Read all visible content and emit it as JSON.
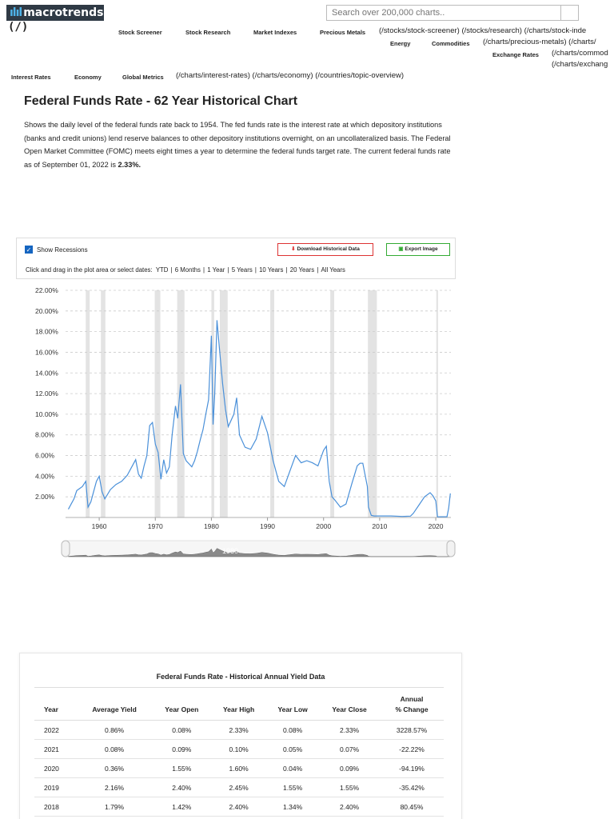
{
  "header": {
    "logo": "macrotrends",
    "logo_link": "(/)",
    "search_placeholder": "Search over 200,000 charts.."
  },
  "nav": {
    "stock_screener": "Stock Screener",
    "stock_research": "Stock Research",
    "market_indexes": "Market Indexes",
    "precious_metals": "Precious Metals",
    "energy": "Energy",
    "commodities": "Commodities",
    "exchange_rates": "Exchange Rates",
    "interest_rates": "Interest Rates",
    "economy": "Economy",
    "global_metrics": "Global Metrics",
    "links_1": "(/stocks/stock-screener) (/stocks/research) (/charts/stock-inde",
    "links_2": "(/charts/precious-metals) (/charts/",
    "links_3": "(/charts/commod",
    "links_4": "(/charts/exchang",
    "links_5": "(/charts/interest-rates) (/charts/economy) (/countries/topic-overview)"
  },
  "page": {
    "title": "Federal Funds Rate - 62 Year Historical Chart",
    "intro_main": "Shows the daily level of the federal funds rate back to 1954. The fed funds rate is the interest rate at which depository institutions (banks and credit unions) lend reserve balances to other depository institutions overnight, on an uncollateralized basis. The Federal Open Market Committee (FOMC) meets eight times a year to determine the federal funds target rate. The current federal funds rate as of September 01, 2022 is ",
    "intro_value": "2.33%."
  },
  "controls": {
    "show_recessions": "Show Recessions",
    "download": "Download Historical Data",
    "export": "Export Image",
    "dates_label": "Click and drag in the plot area or select dates:",
    "ranges": [
      "YTD",
      "6 Months",
      "1 Year",
      "5 Years",
      "10 Years",
      "20 Years",
      "All Years"
    ]
  },
  "colors": {
    "line": "#4a90d9",
    "recession": "#e3e3e3",
    "grid": "#cccccc"
  },
  "chart_data": {
    "type": "line",
    "title": "",
    "xlabel": "",
    "ylabel": "",
    "xlim": [
      1954,
      2022.7
    ],
    "ylim": [
      0,
      22
    ],
    "y_ticks": [
      "2.00%",
      "4.00%",
      "6.00%",
      "8.00%",
      "10.00%",
      "12.00%",
      "14.00%",
      "16.00%",
      "18.00%",
      "20.00%",
      "22.00%"
    ],
    "y_tick_values": [
      2,
      4,
      6,
      8,
      10,
      12,
      14,
      16,
      18,
      20,
      22
    ],
    "x_ticks": [
      "1960",
      "1970",
      "1980",
      "1990",
      "2000",
      "2010",
      "2020"
    ],
    "x_tick_values": [
      1960,
      1970,
      1980,
      1990,
      2000,
      2010,
      2020
    ],
    "recessions": [
      [
        1957.6,
        1958.3
      ],
      [
        1960.3,
        1961.1
      ],
      [
        1969.9,
        1970.9
      ],
      [
        1973.9,
        1975.2
      ],
      [
        1980.0,
        1980.5
      ],
      [
        1981.5,
        1982.9
      ],
      [
        1990.5,
        1991.2
      ],
      [
        2001.2,
        2001.9
      ],
      [
        2007.9,
        2009.5
      ],
      [
        2020.1,
        2020.4
      ]
    ],
    "navigator_label": "1980",
    "series": [
      {
        "x": [
          1954.5,
          1955,
          1955.5,
          1956,
          1956.5,
          1957,
          1957.6,
          1958,
          1958.5,
          1959,
          1959.5,
          1960,
          1960.5,
          1961,
          1962,
          1963,
          1964,
          1965,
          1966,
          1966.5,
          1967,
          1967.5,
          1968,
          1968.5,
          1969,
          1969.5,
          1970,
          1970.5,
          1971,
          1971.5,
          1972,
          1972.5,
          1973,
          1973.6,
          1974,
          1974.5,
          1975,
          1975.5,
          1976,
          1976.5,
          1977,
          1977.5,
          1978,
          1978.5,
          1979,
          1979.5,
          1980,
          1980.3,
          1980.6,
          1981,
          1981.5,
          1982,
          1982.5,
          1983,
          1984,
          1984.5,
          1985,
          1986,
          1987,
          1988,
          1989,
          1990,
          1991,
          1992,
          1993,
          1994,
          1995,
          1996,
          1997,
          1998,
          1999,
          2000,
          2000.5,
          2001,
          2001.5,
          2002,
          2003,
          2004,
          2005,
          2006,
          2006.5,
          2007,
          2007.8,
          2008,
          2008.5,
          2009,
          2010,
          2012,
          2014,
          2015.5,
          2016,
          2017,
          2018,
          2019,
          2019.5,
          2020,
          2020.3,
          2021,
          2022,
          2022.3,
          2022.6
        ],
        "y": [
          0.8,
          1.3,
          1.8,
          2.6,
          2.8,
          3.0,
          3.5,
          1.0,
          1.5,
          2.5,
          3.5,
          4.0,
          2.5,
          1.8,
          2.7,
          3.2,
          3.5,
          4.1,
          5.1,
          5.6,
          4.2,
          3.8,
          5.0,
          6.0,
          8.9,
          9.2,
          7.1,
          6.3,
          3.7,
          5.6,
          4.3,
          4.9,
          8.0,
          10.8,
          9.6,
          12.9,
          6.2,
          5.5,
          5.2,
          4.9,
          5.5,
          6.4,
          7.5,
          8.5,
          10.0,
          11.4,
          17.6,
          9.0,
          12.0,
          19.1,
          16.0,
          13.0,
          10.5,
          8.8,
          10.0,
          11.6,
          8.0,
          6.8,
          6.6,
          7.6,
          9.8,
          8.2,
          5.5,
          3.5,
          3.0,
          4.5,
          6.0,
          5.3,
          5.5,
          5.3,
          5.0,
          6.5,
          6.9,
          3.5,
          2.0,
          1.7,
          1.0,
          1.3,
          3.2,
          5.0,
          5.25,
          5.25,
          3.0,
          1.0,
          0.2,
          0.15,
          0.15,
          0.15,
          0.1,
          0.13,
          0.4,
          1.2,
          2.0,
          2.4,
          2.1,
          1.6,
          0.06,
          0.07,
          0.08,
          0.9,
          2.33
        ]
      }
    ]
  },
  "table": {
    "title": "Federal Funds Rate - Historical Annual Yield Data",
    "headers": [
      "Year",
      "Average Yield",
      "Year Open",
      "Year High",
      "Year Low",
      "Year Close",
      "Annual % Change"
    ],
    "rows": [
      [
        "2022",
        "0.86%",
        "0.08%",
        "2.33%",
        "0.08%",
        "2.33%",
        "3228.57%"
      ],
      [
        "2021",
        "0.08%",
        "0.09%",
        "0.10%",
        "0.05%",
        "0.07%",
        "-22.22%"
      ],
      [
        "2020",
        "0.36%",
        "1.55%",
        "1.60%",
        "0.04%",
        "0.09%",
        "-94.19%"
      ],
      [
        "2019",
        "2.16%",
        "2.40%",
        "2.45%",
        "1.55%",
        "1.55%",
        "-35.42%"
      ],
      [
        "2018",
        "1.79%",
        "1.42%",
        "2.40%",
        "1.34%",
        "2.40%",
        "80.45%"
      ]
    ]
  }
}
